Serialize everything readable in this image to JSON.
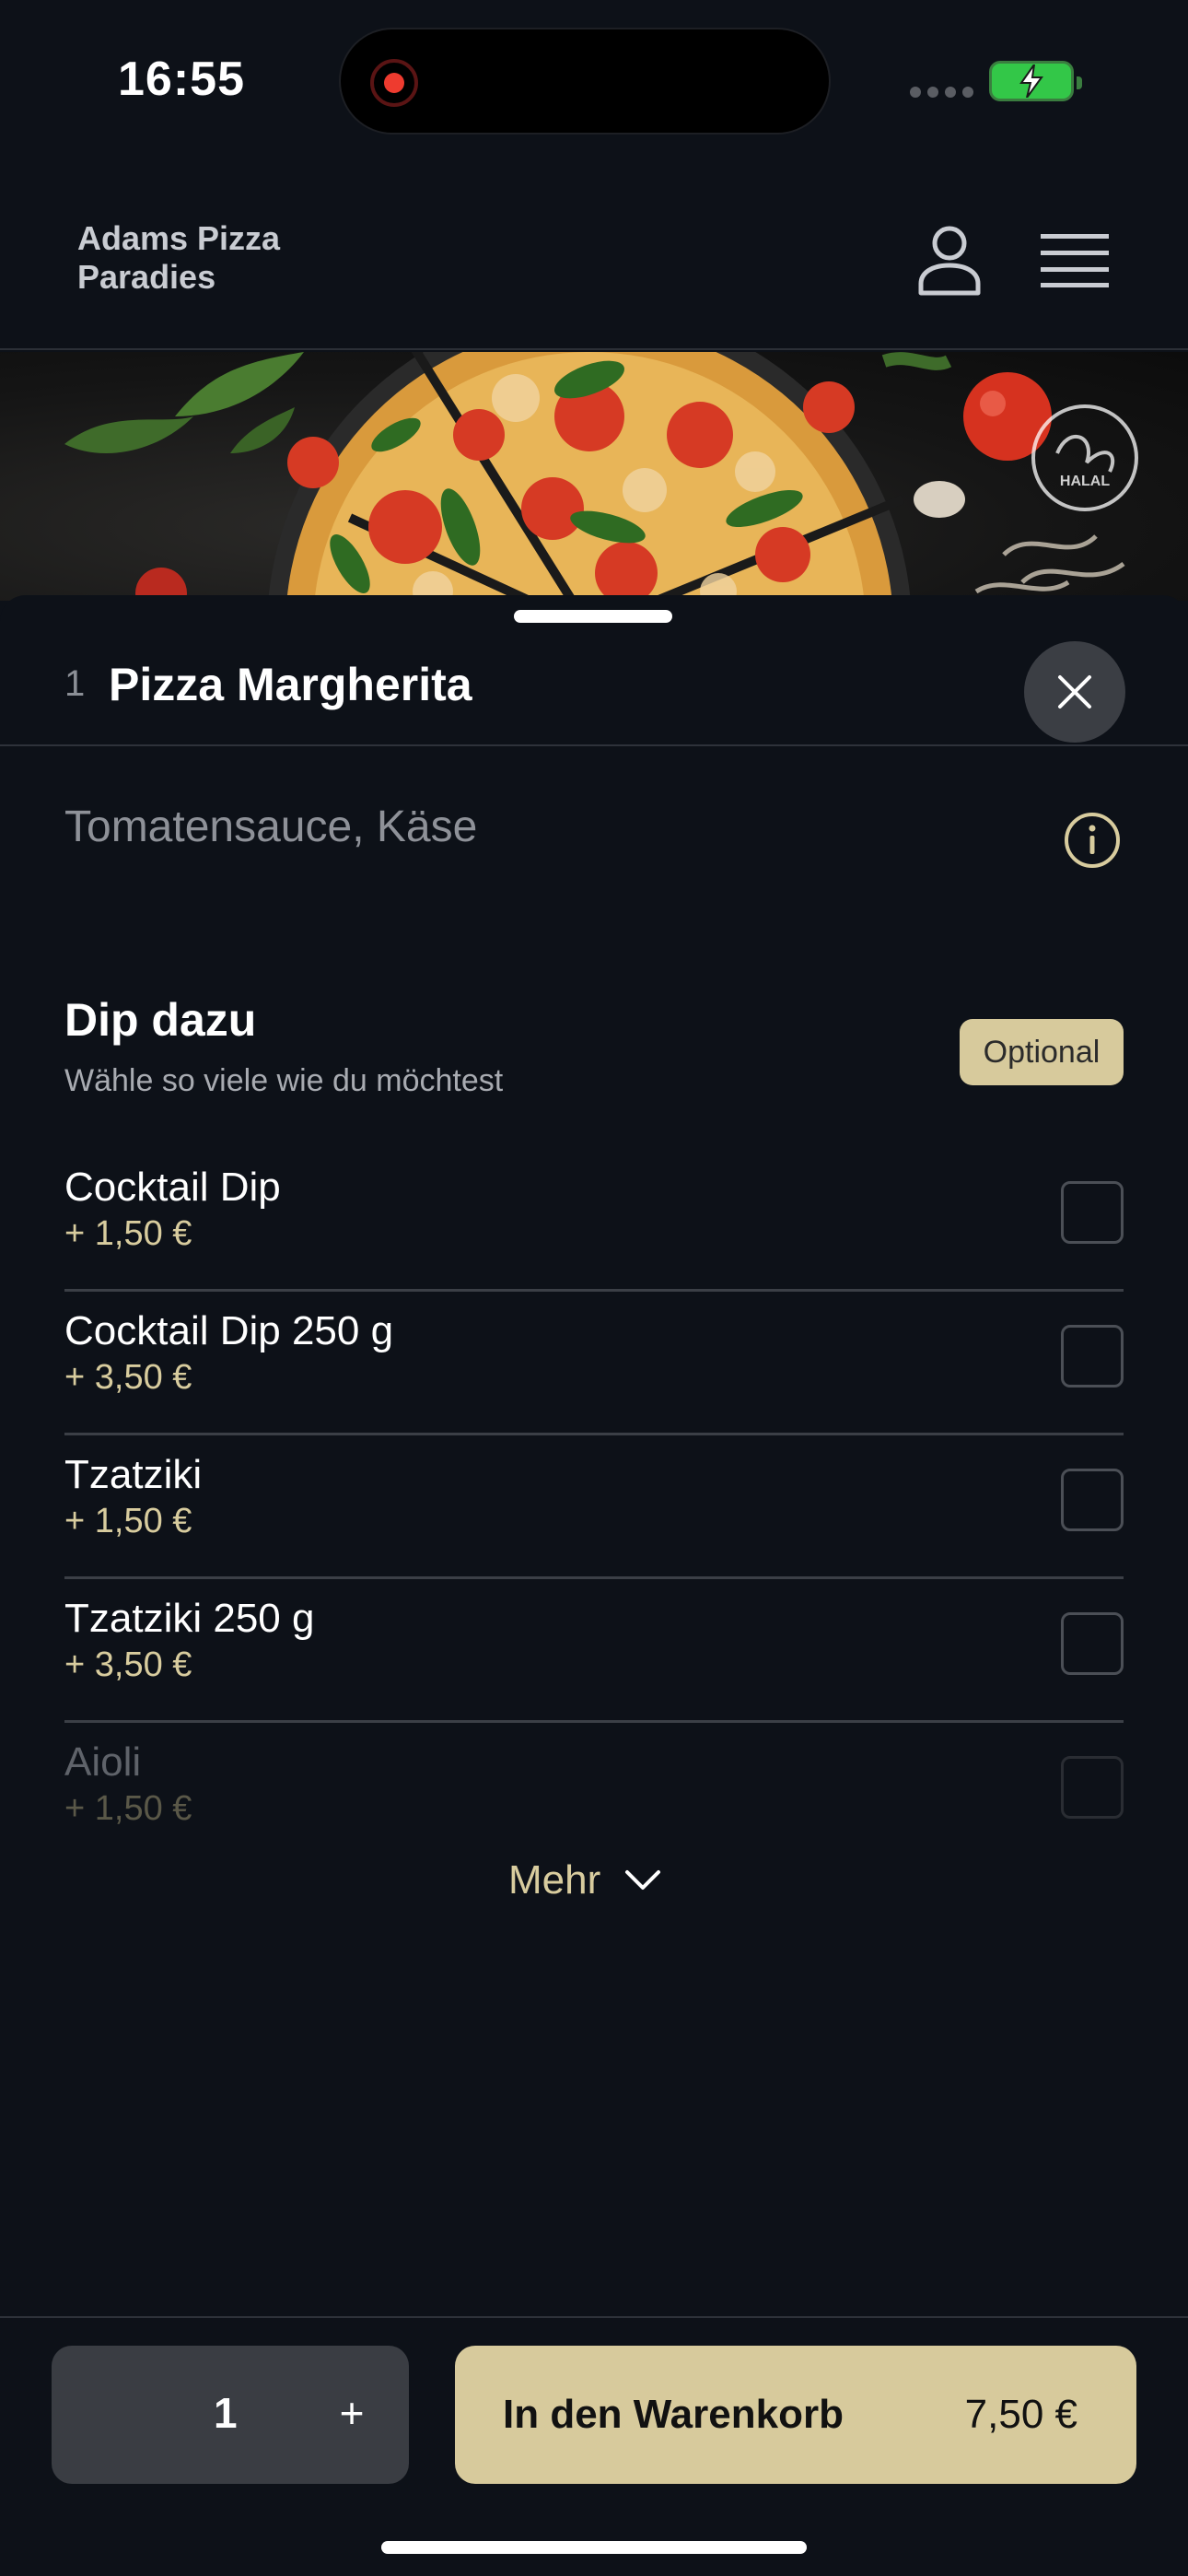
{
  "status_bar": {
    "time": "16:55"
  },
  "header": {
    "brand": "Adams Pizza Paradies",
    "icons": [
      "user-icon",
      "menu-icon"
    ]
  },
  "banner": {
    "badge_text": "HALAL"
  },
  "sheet": {
    "quantity_prefix": "1",
    "title": "Pizza Margherita",
    "ingredients": "Tomatensauce, Käse",
    "group": {
      "title": "Dip dazu",
      "subtitle": "Wähle so viele wie du möchtest",
      "badge": "Optional",
      "options": [
        {
          "name": "Cocktail Dip",
          "price": "+ 1,50 €",
          "checked": false
        },
        {
          "name": "Cocktail Dip 250 g",
          "price": "+ 3,50 €",
          "checked": false
        },
        {
          "name": "Tzatziki",
          "price": "+ 1,50 €",
          "checked": false
        },
        {
          "name": "Tzatziki 250 g",
          "price": "+ 3,50 €",
          "checked": false
        },
        {
          "name": "Aioli",
          "price": "+ 1,50 €",
          "checked": false
        }
      ]
    },
    "more_label": "Mehr"
  },
  "footer": {
    "quantity": "1",
    "plus": "+",
    "cart_label": "In den Warenkorb",
    "cart_price": "7,50 €"
  },
  "colors": {
    "background": "#0d1118",
    "accent": "#d7ca9c",
    "accent_text": "#d8cc9e"
  }
}
